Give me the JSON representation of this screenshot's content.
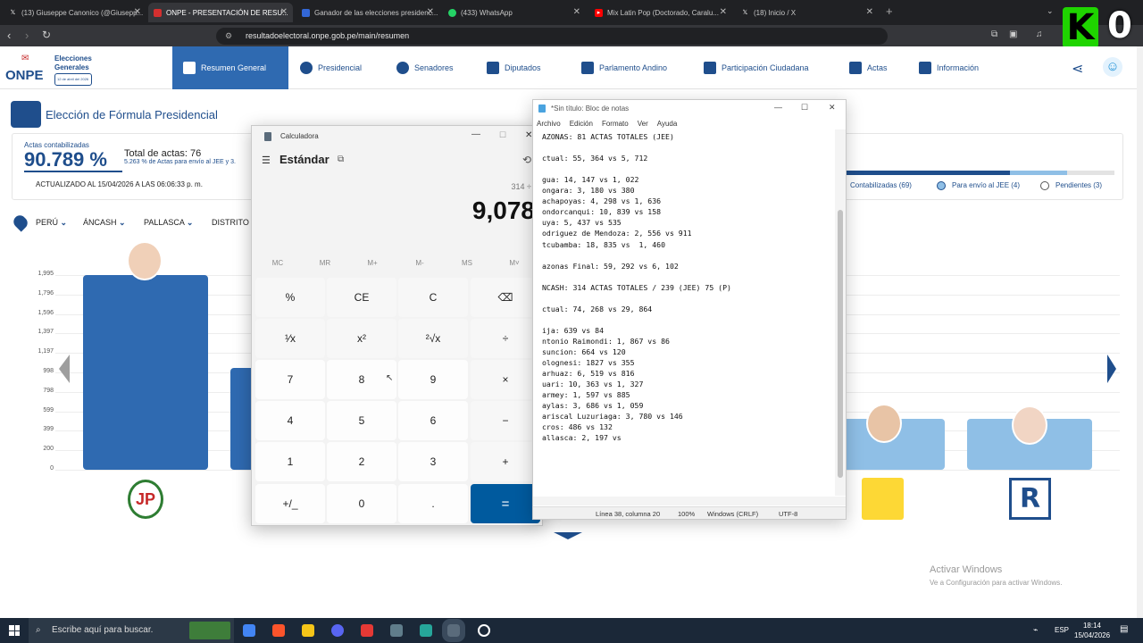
{
  "browser": {
    "tabs": [
      {
        "title": "(13) Giuseppe Canonico (@Giusepp...",
        "icon": "x-icon",
        "active": false
      },
      {
        "title": "ONPE - PRESENTACIÓN DE RESU...",
        "icon": "onpe-icon",
        "active": true
      },
      {
        "title": "Ganador de las elecciones presidenc...",
        "icon": "doc-icon",
        "active": false
      },
      {
        "title": "(433) WhatsApp",
        "icon": "whatsapp-icon",
        "active": false
      },
      {
        "title": "Mix Latin Pop (Doctorado, Caralu...",
        "icon": "youtube-icon",
        "active": false
      },
      {
        "title": "(18) Inicio / X",
        "icon": "x-icon",
        "active": false
      }
    ],
    "url": "resultadoelectoral.onpe.gob.pe/main/resumen"
  },
  "overlay": {
    "letter": "K",
    "digit": "0",
    "color": "#1fd400"
  },
  "header": {
    "logo": "ONPE",
    "logo_sub1": "Elecciones",
    "logo_sub2": "Generales",
    "logo_date": "12 de abril del 2026",
    "nav": [
      {
        "label": "Resumen General",
        "active": true
      },
      {
        "label": "Presidencial"
      },
      {
        "label": "Senadores"
      },
      {
        "label": "Diputados"
      },
      {
        "label": "Parlamento Andino"
      },
      {
        "label": "Participación Ciudadana"
      },
      {
        "label": "Actas"
      },
      {
        "label": "Información"
      }
    ]
  },
  "page": {
    "title": "Elección de Fórmula Presidencial",
    "actas_label": "Actas contabilizadas",
    "actas_pct": "90.789 %",
    "total_actas": "Total de actas: 76",
    "envio_note": "5.263 % de Actas para envío al JEE y 3.",
    "updated": "ACTUALIZADO AL 15/04/2026 A LAS 06:06:33 p. m.",
    "legend": {
      "contabilizadas": "Contabilizadas (69)",
      "jee": "Para envío al JEE (4)",
      "pendientes": "Pendientes (3)"
    },
    "breadcrumb": {
      "country": "PERÚ",
      "region": "ÁNCASH",
      "province": "PALLASCA",
      "district": "DISTRITO"
    },
    "colors": {
      "primary": "#2f6ab1",
      "light": "#8fbfe6",
      "dark": "#1f4e8c"
    }
  },
  "chart_data": {
    "type": "bar",
    "yticks": [
      "0",
      "200",
      "399",
      "599",
      "798",
      "998",
      "1,197",
      "1,397",
      "1,596",
      "1,796",
      "1,995"
    ],
    "ylim": [
      0,
      1995
    ],
    "series": [
      {
        "values": [
          1995,
          1040,
          520,
          520
        ]
      }
    ]
  },
  "calculator": {
    "title": "Calculadora",
    "mode": "Estándar",
    "history": "314 ÷",
    "display": "9,078",
    "memory": [
      "MC",
      "MR",
      "M+",
      "M-",
      "MS",
      "M˅"
    ],
    "keys": [
      [
        "%",
        "CE",
        "C",
        "⌫"
      ],
      [
        "¹⁄x",
        "x²",
        "²√x",
        "÷"
      ],
      [
        "7",
        "8",
        "9",
        "×"
      ],
      [
        "4",
        "5",
        "6",
        "−"
      ],
      [
        "1",
        "2",
        "3",
        "+"
      ],
      [
        "+/_",
        "0",
        ".",
        "="
      ]
    ]
  },
  "notepad": {
    "title": "*Sin título: Bloc de notas",
    "menu": [
      "Archivo",
      "Edición",
      "Formato",
      "Ver",
      "Ayuda"
    ],
    "lines": [
      "AZONAS: 81 ACTAS TOTALES (JEE)",
      "",
      "ctual: 55, 364 vs 5, 712",
      "",
      "gua: 14, 147 vs 1, 022",
      "ongara: 3, 180 vs 380",
      "achapoyas: 4, 298 vs 1, 636",
      "ondorcanqui: 10, 839 vs 158",
      "uya: 5, 437 vs 535",
      "odriguez de Mendoza: 2, 556 vs 911",
      "tcubamba: 18, 835 vs  1, 460",
      "",
      "azonas Final: 59, 292 vs 6, 102",
      "",
      "NCASH: 314 ACTAS TOTALES / 239 (JEE) 75 (P)",
      "",
      "ctual: 74, 268 vs 29, 864",
      "",
      "ija: 639 vs 84",
      "ntonio Raimondi: 1, 867 vs 86",
      "suncion: 664 vs 120",
      "olognesi: 1827 vs 355",
      "arhuaz: 6, 519 vs 816",
      "uari: 10, 363 vs 1, 327",
      "armey: 1, 597 vs 885",
      "aylas: 3, 686 vs 1, 059",
      "ariscal Luzuriaga: 3, 780 vs 146",
      "cros: 486 vs 132",
      "allasca: 2, 197 vs"
    ],
    "status": {
      "position": "Línea 38, columna 20",
      "zoom": "100%",
      "eol": "Windows (CRLF)",
      "encoding": "UTF-8"
    }
  },
  "watermark": {
    "line1": "Activar Windows",
    "line2": "Ve a Configuración para activar Windows."
  },
  "taskbar": {
    "search": "Escribe aquí para buscar.",
    "lang": "ESP",
    "time": "18:14",
    "date": "15/04/2026"
  }
}
